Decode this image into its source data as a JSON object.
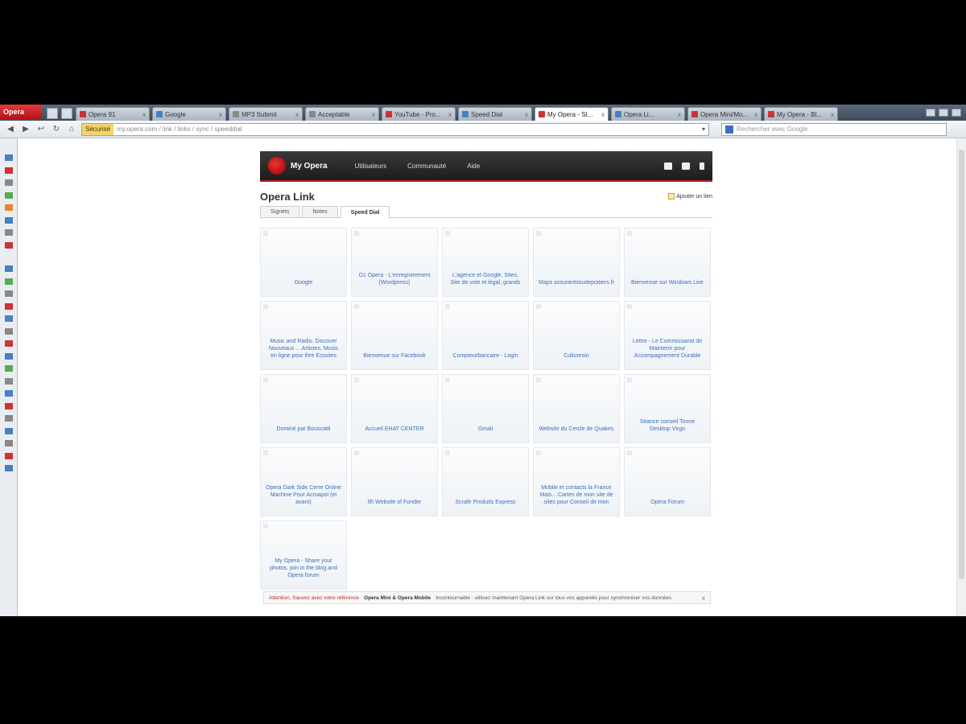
{
  "browser": {
    "menu_label": "Opera",
    "tabs": [
      {
        "label": "Opera 91",
        "favicon": "red",
        "active": false
      },
      {
        "label": "Google",
        "favicon": "blue",
        "active": false
      },
      {
        "label": "MP3 Submit",
        "favicon": "gray",
        "active": false
      },
      {
        "label": "Acceptable",
        "favicon": "gray",
        "active": false
      },
      {
        "label": "YouTube - Pro...",
        "favicon": "red",
        "active": false
      },
      {
        "label": "Speed Dial",
        "favicon": "blue",
        "active": false
      },
      {
        "label": "My Opera - St...",
        "favicon": "red",
        "active": true
      },
      {
        "label": "Opera Li...",
        "favicon": "blue",
        "active": false
      },
      {
        "label": "Opera Mini/Mo...",
        "favicon": "red",
        "active": false
      },
      {
        "label": "My Opera - Bl...",
        "favicon": "red",
        "active": false
      }
    ],
    "tab_close": "x",
    "address": {
      "secure_label": "Sécurisé",
      "url": "my.opera.com  /  link  /  links  /  sync  /  speeddial",
      "dropdown": "▾"
    },
    "search_placeholder": "Rechercher avec Google"
  },
  "page": {
    "brand": "My Opera",
    "nav": [
      "Utilisateurs",
      "Communauté",
      "Aide"
    ],
    "title": "Opera Link",
    "add_link": "Ajouter un lien",
    "tabs": [
      "Signets",
      "Notes",
      "Speed Dial"
    ],
    "active_tab": 2,
    "speed_dials": [
      "Google",
      "O1 Opera - L'enregistrement (Wordpress)",
      "L'agence et Google, Sites, Site de vote et légal, grands",
      "Maps assurantsoudepoitiers.fr",
      "Bienvenue sur Windows Live",
      "Music and Radio: Discover Nouveaux ... Artistes, Music en ligne pour être Ecoutes",
      "Bienvenue sur Facebook",
      "Compteurbancaire - Login",
      "Culturesin",
      "Lettre - Le Commissariat de Maintenir pour Accompagnement Durable",
      "Dominé par Bouscattl",
      "Accueil EHAT CENTER",
      "Gmail",
      "Website du Cercle de Quakes",
      "Séance conseil Tonne Desktop Virgo",
      "Opera Dark Side Cerre Online Machine Pour Acroapol (et avant)",
      "Ilh Website of Fonder",
      "Scrafe Produits Express",
      "Mobile et contacts la France Mais... Cartes de mon site de sites pour Conseil de mon",
      "Opera Forum",
      "My Opera - Share your photos, join in the blog and Opera forum"
    ],
    "notice": {
      "warning": "Attention, Sauvez avec votre référence",
      "product": "Opera Mini & Opera Mobile",
      "message": "Incontournable : utilisez maintenant Opera Link sur tous vos appareils pour synchroniser vos données",
      "close": "x"
    }
  }
}
